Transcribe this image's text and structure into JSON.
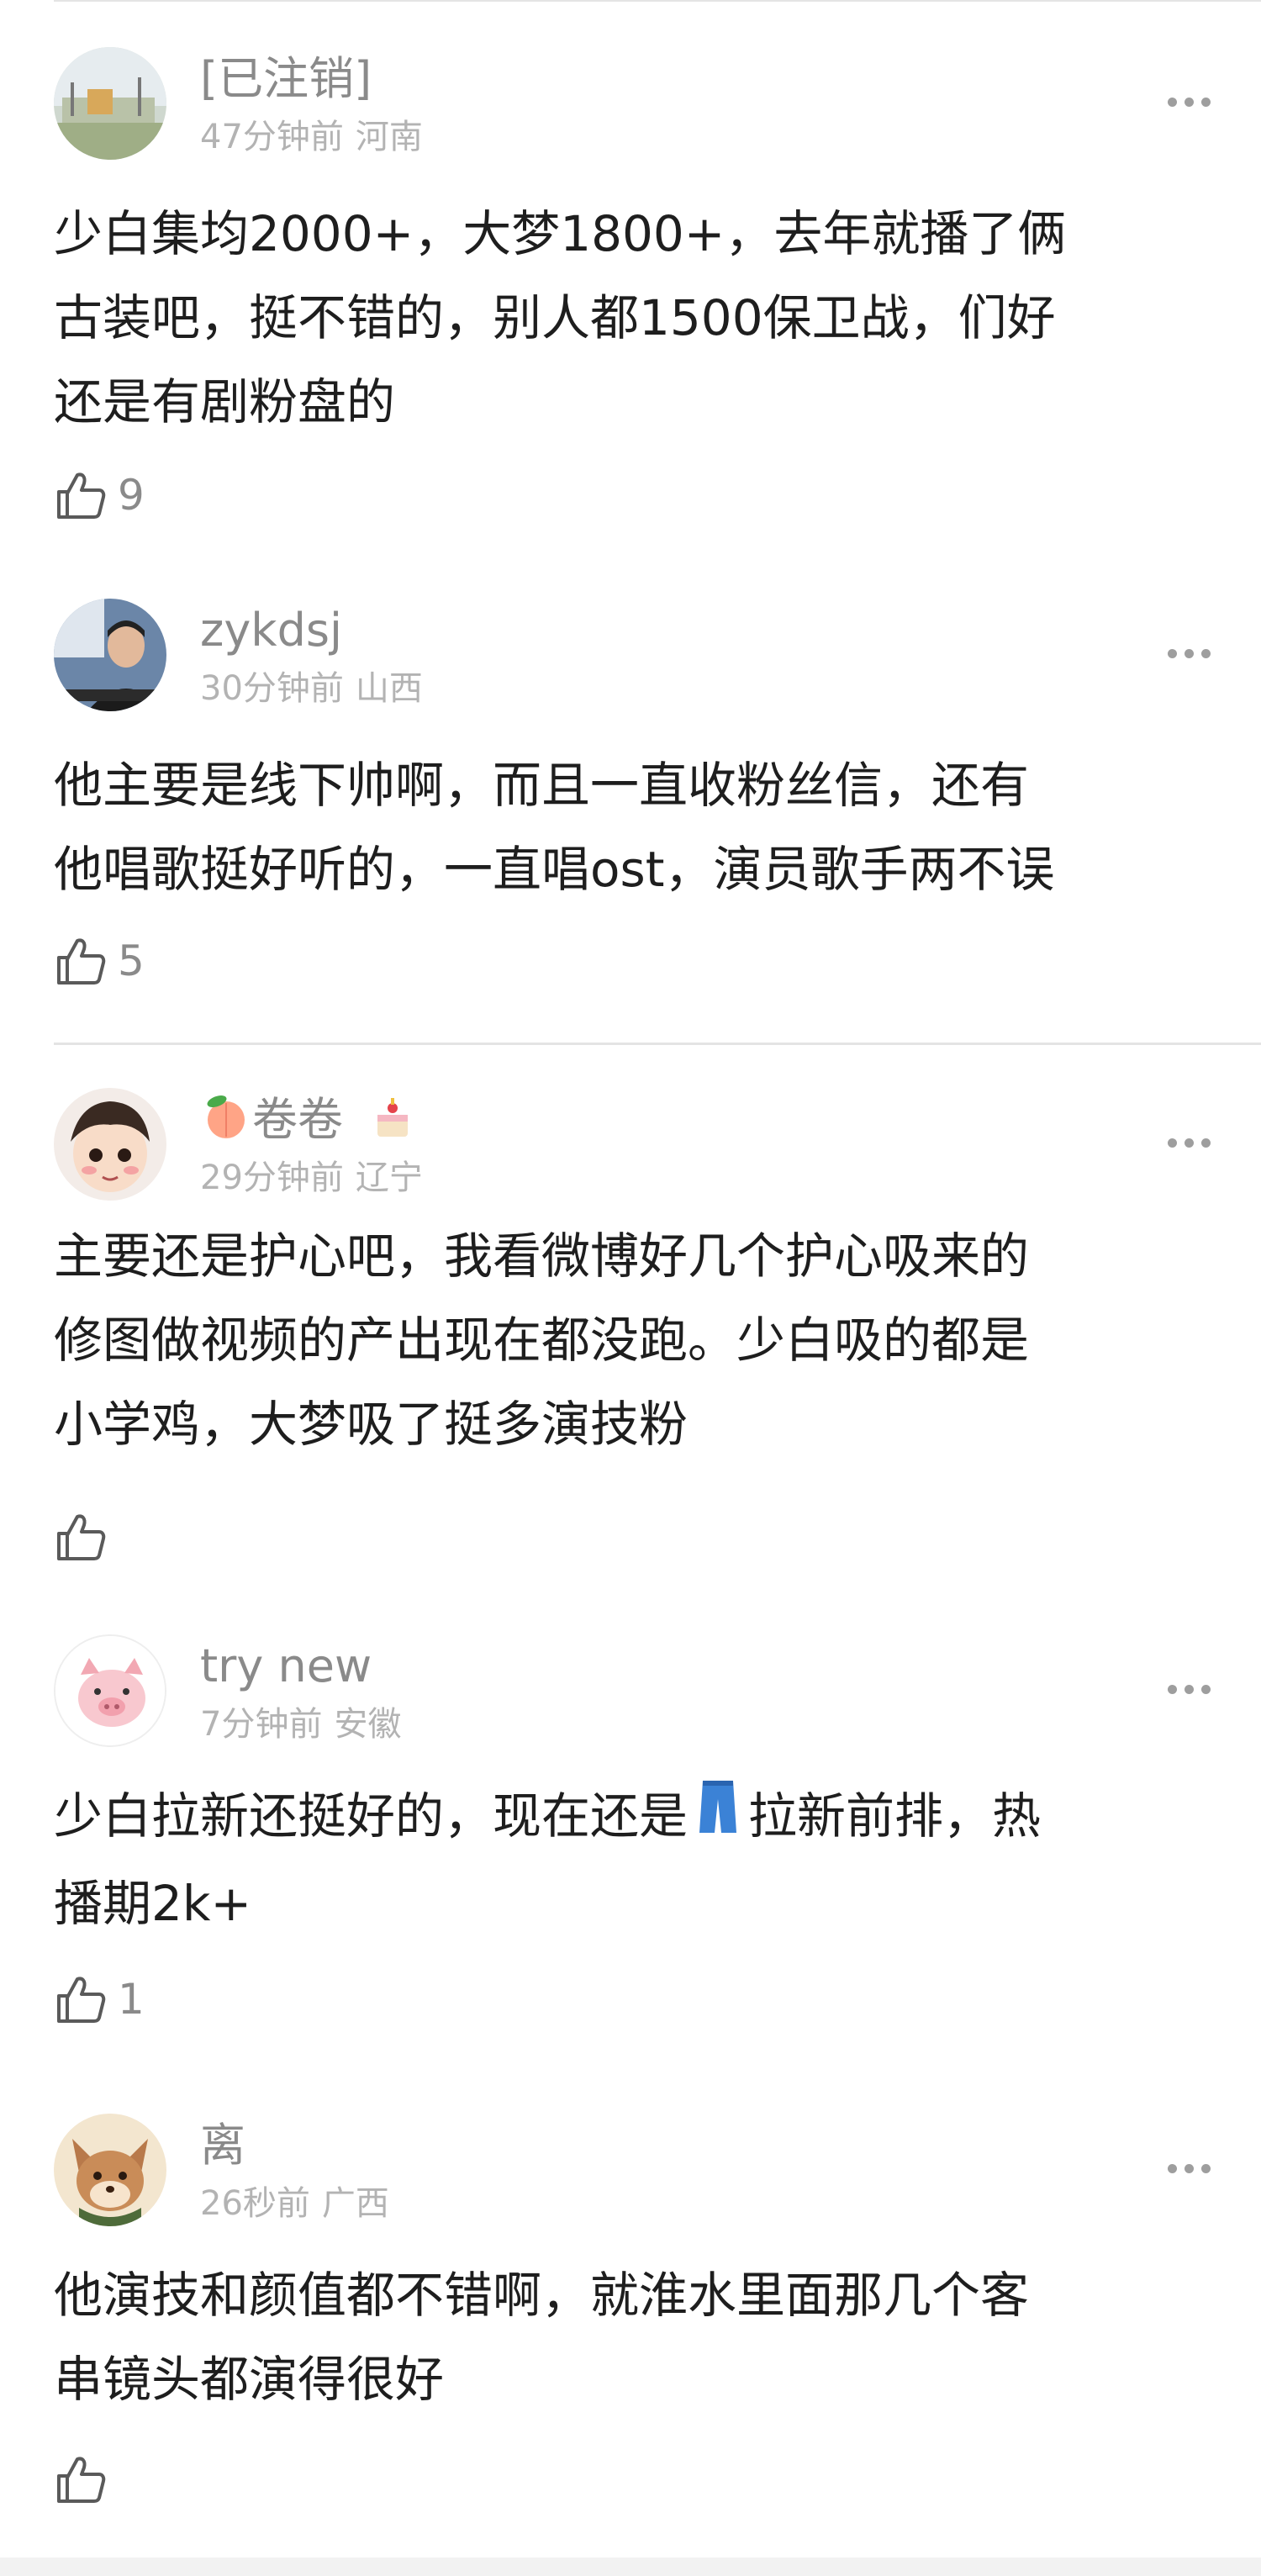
{
  "comments": [
    {
      "username": "[已注销]",
      "time": "47分钟前",
      "location": "河南",
      "text": [
        "少白集均2000+，大梦1800+，去年就播了俩",
        "古装吧，挺不错的，别人都1500保卫战，们好",
        "还是有剧粉盘的"
      ],
      "likes": "9",
      "avatar": "landscape-photo-avatar"
    },
    {
      "username": "zykdsj",
      "time": "30分钟前",
      "location": "山西",
      "text": [
        "他主要是线下帅啊，而且一直收粉丝信，还有",
        "他唱歌挺好听的，一直唱ost，演员歌手两不误"
      ],
      "likes": "5",
      "avatar": "man-photo-avatar"
    },
    {
      "username": "卷卷",
      "time": "29分钟前",
      "location": "辽宁",
      "text": [
        "主要还是护心吧，我看微博好几个护心吸来的",
        "修图做视频的产出现在都没跑。少白吸的都是",
        "小学鸡，大梦吸了挺多演技粉"
      ],
      "likes": "",
      "avatar": "cartoon-boy-avatar",
      "name_prefix_icon": "peach-emoji",
      "name_suffix_icon": "cake-emoji"
    },
    {
      "username": "try new",
      "time": "7分钟前",
      "location": "安徽",
      "text_before_icon": "少白拉新还挺好的，现在还是",
      "inline_icon": "jeans-emoji",
      "text_after_icon": "拉新前排，热",
      "text_line2": "播期2k+",
      "likes": "1",
      "avatar": "pig-avatar"
    },
    {
      "username": "离",
      "time": "26秒前",
      "location": "广西",
      "text": [
        "他演技和颜值都不错啊，就淮水里面那几个客",
        "串镜头都演得很好"
      ],
      "likes": "",
      "avatar": "cartoon-fox-avatar"
    }
  ],
  "icons": {
    "like": "thumbs-up-icon",
    "more": "more-options-icon"
  },
  "colors": {
    "name": "#8a8a8a",
    "meta": "#b3b3b3",
    "text": "#1e1e1e",
    "divider": "#e4e4e4"
  }
}
